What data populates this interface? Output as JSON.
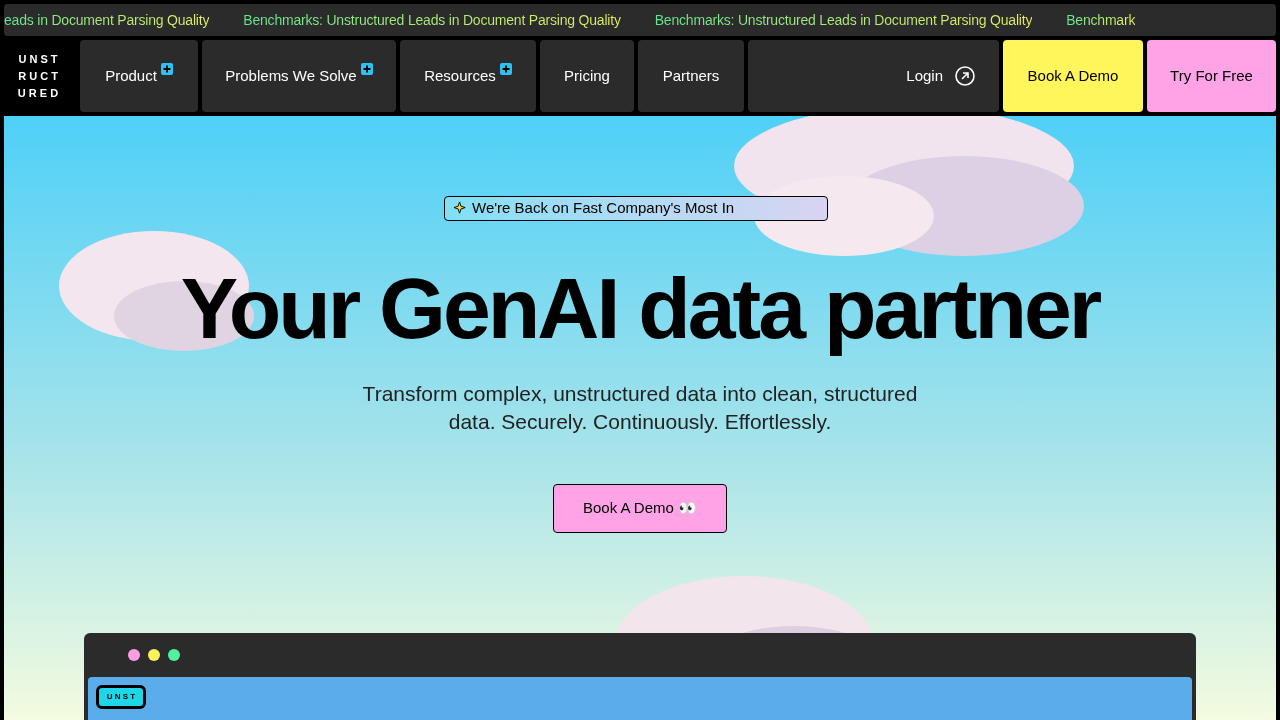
{
  "ticker": [
    "eads in Document Parsing Quality",
    "Benchmarks: Unstructured Leads in Document Parsing Quality",
    "Benchmarks: Unstructured Leads in Document Parsing Quality",
    "Benchmark"
  ],
  "logo": [
    "U N S T",
    "R U C T",
    "U R E D"
  ],
  "nav": [
    {
      "label": "Product",
      "expandable": true
    },
    {
      "label": "Problems We Solve",
      "expandable": true
    },
    {
      "label": "Resources",
      "expandable": true
    },
    {
      "label": "Pricing",
      "expandable": false
    },
    {
      "label": "Partners",
      "expandable": false
    }
  ],
  "login": "Login",
  "cta_buttons": [
    {
      "label": "Book A Demo",
      "color": "#fef65b"
    },
    {
      "label": "Try For Free",
      "color": "#ffa3e7"
    }
  ],
  "hero": {
    "badge": "We're Back on Fast Company's Most In",
    "title": "Your GenAI data partner",
    "subtitle": "Transform complex, unstructured data into clean, structured data. Securely. Continuously. Effortlessly.",
    "button": "Book A Demo 👀"
  },
  "preview": {
    "dots": [
      {
        "color": "#ff9ee6"
      },
      {
        "color": "#fdf25b"
      },
      {
        "color": "#52f29a"
      }
    ],
    "logo": "U N S T"
  }
}
